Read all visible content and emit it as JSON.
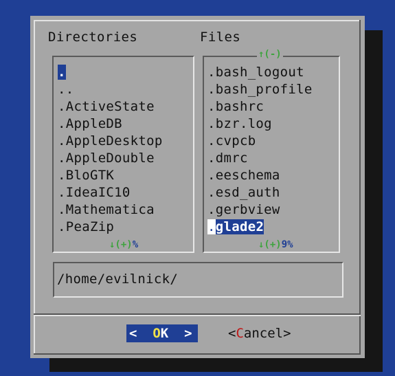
{
  "dialog": {
    "directories_label": "Directories",
    "files_label": "Files",
    "directories": [
      ".",
      "..",
      ".ActiveState",
      ".AppleDB",
      ".AppleDesktop",
      ".AppleDouble",
      ".BloGTK",
      ".IdeaIC10",
      ".Mathematica",
      ".PeaZip"
    ],
    "directories_selected_index": 0,
    "files": [
      ".bash_logout",
      ".bash_profile",
      ".bashrc",
      ".bzr.log",
      ".cvpcb",
      ".dmrc",
      ".eeschema",
      ".esd_auth",
      ".gerbview",
      ".glade2"
    ],
    "files_selected_index": 9,
    "files_top_indicator": "↑(-)",
    "directories_bottom_indicator": "↓(+)",
    "directories_percent": "%",
    "files_bottom_indicator": "↓(+)",
    "files_percent": "9%",
    "path_value": "/home/evilnick/",
    "ok_button": {
      "left": "<  ",
      "hotkey": "O",
      "rest": "K",
      "right": "  >"
    },
    "cancel_button": {
      "left": "<",
      "hotkey": "C",
      "rest": "ancel",
      "right": ">"
    }
  },
  "colors": {
    "background": "#1f3f95",
    "dialog": "#a6a6a6",
    "shadow": "#161616",
    "indicator_green": "#3fa33f",
    "hotkey_yellow": "#f0e04a",
    "hotkey_red": "#c01818"
  }
}
